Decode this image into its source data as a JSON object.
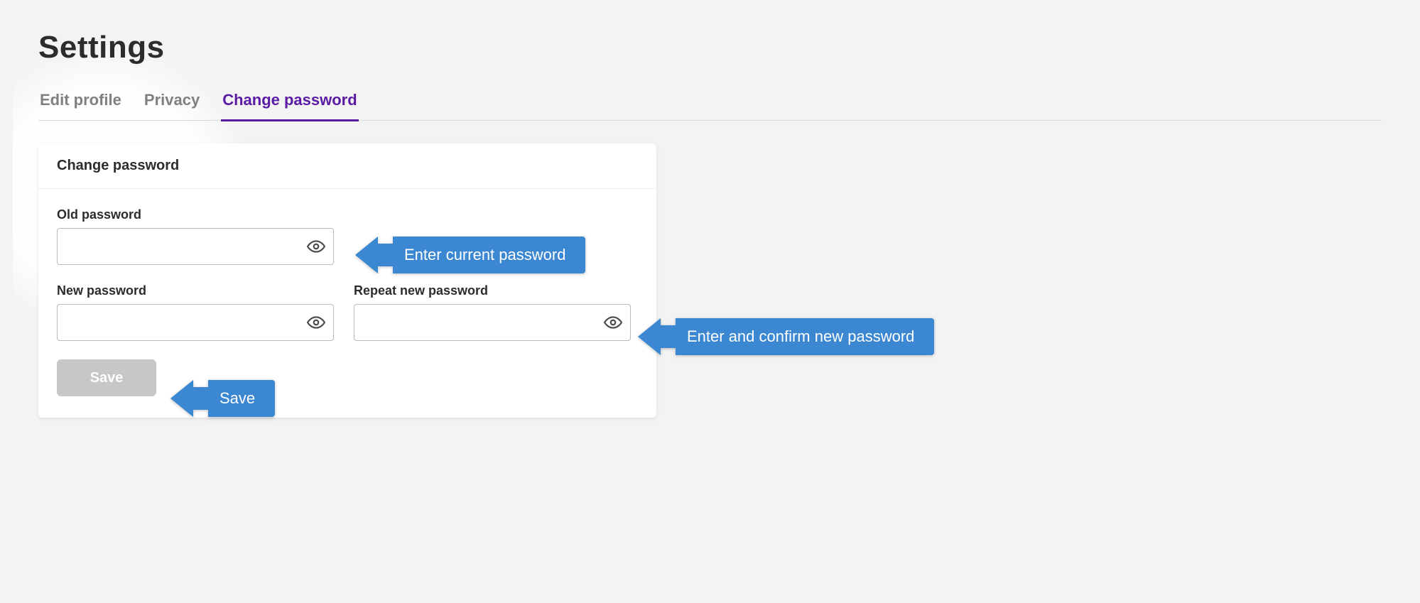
{
  "page": {
    "title": "Settings"
  },
  "tabs": {
    "items": [
      {
        "label": "Edit profile",
        "active": false
      },
      {
        "label": "Privacy",
        "active": false
      },
      {
        "label": "Change password",
        "active": true
      }
    ]
  },
  "panel": {
    "heading": "Change password",
    "fields": {
      "old": {
        "label": "Old password",
        "value": ""
      },
      "new": {
        "label": "New password",
        "value": ""
      },
      "repeat": {
        "label": "Repeat new password",
        "value": ""
      }
    },
    "save_label": "Save"
  },
  "annotations": {
    "enter_current": "Enter current password",
    "enter_new": "Enter and confirm new password",
    "save": "Save"
  },
  "colors": {
    "accent": "#5a1aa3",
    "annotation": "#3b87d1",
    "button_disabled": "#c7c7c7"
  }
}
